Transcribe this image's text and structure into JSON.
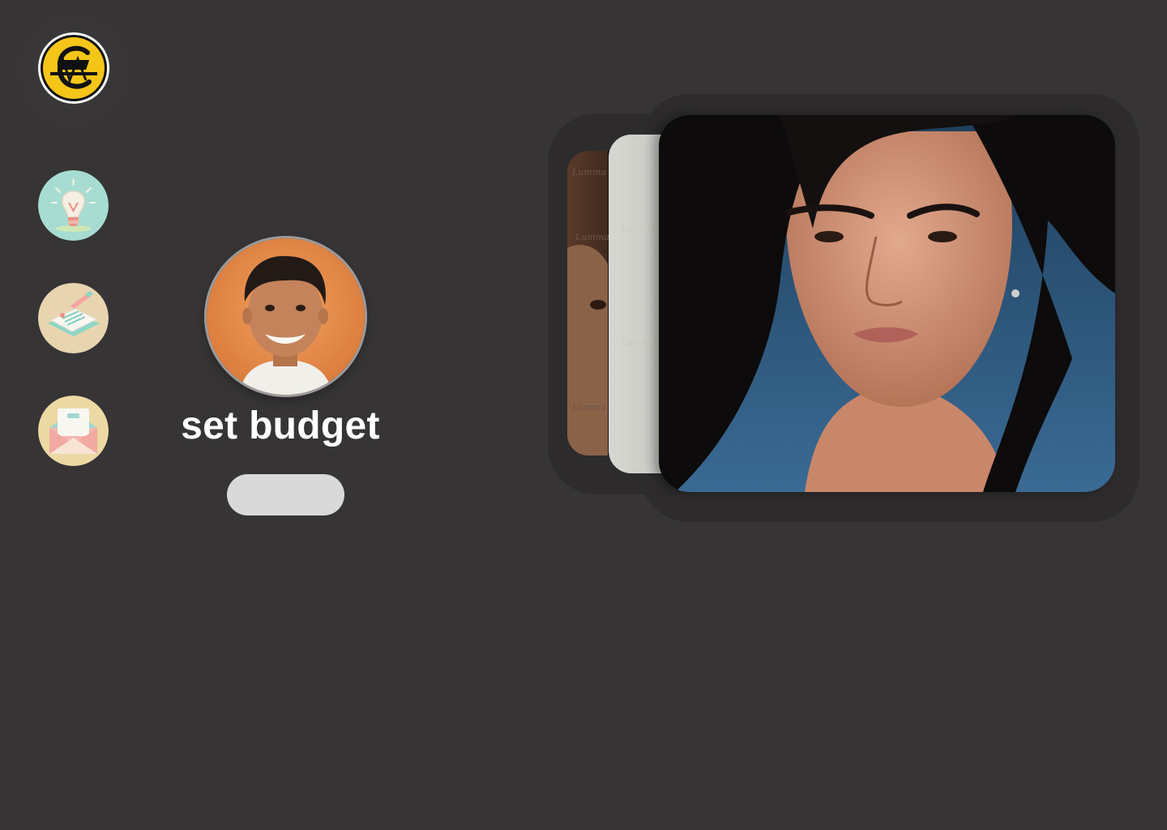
{
  "app": {
    "logo_icon": "euro-currency-logo"
  },
  "sidebar": {
    "items": [
      {
        "name": "ideas",
        "icon": "lightbulb-icon",
        "bg": "#a7dcd2"
      },
      {
        "name": "budget-notes",
        "icon": "notepad-icon",
        "bg": "#e8d5b0"
      },
      {
        "name": "messages",
        "icon": "envelope-icon",
        "bg": "#ecd9a4"
      }
    ]
  },
  "profile": {
    "avatar": "user-avatar",
    "title": "set budget",
    "button_label": ""
  },
  "gallery": {
    "cards": [
      {
        "name": "portrait-woman-blue-sky"
      },
      {
        "name": "plain-grey-card"
      },
      {
        "name": "portrait-woman-watermarked"
      }
    ]
  },
  "colors": {
    "background": "#363435",
    "title_text": "#ffffff",
    "button_fill": "#d9d9d9",
    "logo_yellow": "#f5c518",
    "card_sky": "#2a4d6e"
  }
}
